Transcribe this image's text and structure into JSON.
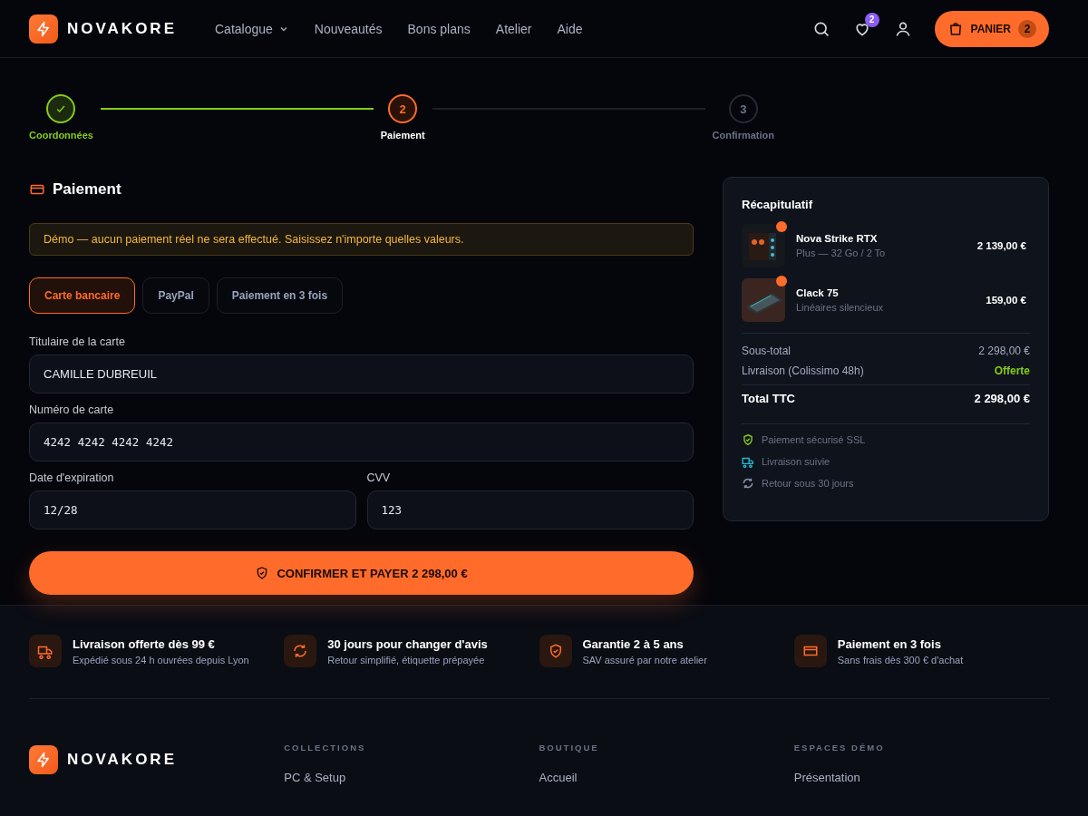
{
  "header": {
    "brand": "NOVAKORE",
    "nav": [
      {
        "label": "Catalogue",
        "has_menu": true
      },
      {
        "label": "Nouveautés",
        "has_menu": false
      },
      {
        "label": "Bons plans",
        "has_menu": false
      },
      {
        "label": "Atelier",
        "has_menu": false
      },
      {
        "label": "Aide",
        "has_menu": false
      }
    ],
    "wishlist_count": "2",
    "cart": {
      "label": "PANIER",
      "count": "2"
    }
  },
  "steps": [
    {
      "label": "Coordonnées",
      "done": true,
      "current": false
    },
    {
      "number": "2",
      "label": "Paiement",
      "done": false,
      "current": true
    },
    {
      "number": "3",
      "label": "Confirmation",
      "done": false,
      "current": false
    }
  ],
  "payment": {
    "title": "Paiement",
    "notice": "Démo — aucun paiement réel ne sera effectué. Saisissez n'importe quelles valeurs.",
    "methods": [
      {
        "label": "Carte bancaire",
        "selected": true
      },
      {
        "label": "PayPal",
        "selected": false
      },
      {
        "label": "Paiement en 3 fois",
        "selected": false
      }
    ],
    "field_rows": [
      [
        {
          "label": "Titulaire de la carte",
          "value": "CAMILLE DUBREUIL",
          "kind": "text"
        }
      ],
      [
        {
          "label": "Numéro de carte",
          "value": "4242 4242 4242 4242",
          "kind": "code"
        }
      ],
      [
        {
          "label": "Date d'expiration",
          "value": "12/28",
          "kind": "code"
        },
        {
          "label": "CVV",
          "value": "123",
          "kind": "code"
        }
      ]
    ],
    "submit": "CONFIRMER ET PAYER 2 298,00 €"
  },
  "summary": {
    "title": "Récapitulatif",
    "items": [
      {
        "name": "Nova Strike RTX",
        "variant": "Plus — 32 Go / 2 To",
        "price": "2 139,00 €",
        "kind": "tower"
      },
      {
        "name": "Clack 75",
        "variant": "Linéaires silencieux",
        "price": "159,00 €",
        "kind": "keyboard"
      }
    ],
    "lines": [
      {
        "label": "Sous-total",
        "value": "2 298,00 €",
        "kind": "normal"
      },
      {
        "label": "Livraison (Colissimo 48h)",
        "value": "Offerte",
        "kind": "free"
      },
      {
        "label": "Total TTC",
        "value": "2 298,00 €",
        "kind": "total"
      }
    ],
    "assurances": [
      {
        "label": "Paiement sécurisé SSL",
        "kind": "shield",
        "color": "#84cc16"
      },
      {
        "label": "Livraison suivie",
        "kind": "truck",
        "color": "#22b8cf"
      },
      {
        "label": "Retour sous 30 jours",
        "kind": "refresh",
        "color": "#8b93a7"
      }
    ]
  },
  "features": [
    {
      "kind": "truck",
      "title": "Livraison offerte dès 99 €",
      "text": "Expédié sous 24 h ouvrées depuis Lyon"
    },
    {
      "kind": "refresh",
      "title": "30 jours pour changer d'avis",
      "text": "Retour simplifié, étiquette prépayée"
    },
    {
      "kind": "shield",
      "title": "Garantie 2 à 5 ans",
      "text": "SAV assuré par notre atelier"
    },
    {
      "kind": "card",
      "title": "Paiement en 3 fois",
      "text": "Sans frais dès 300 € d'achat"
    }
  ],
  "footer": {
    "brand": "NOVAKORE",
    "columns": [
      {
        "heading": "COLLECTIONS",
        "links": [
          "PC & Setup"
        ]
      },
      {
        "heading": "BOUTIQUE",
        "links": [
          "Accueil"
        ]
      },
      {
        "heading": "ESPACES DÉMO",
        "links": [
          "Présentation"
        ]
      }
    ]
  }
}
